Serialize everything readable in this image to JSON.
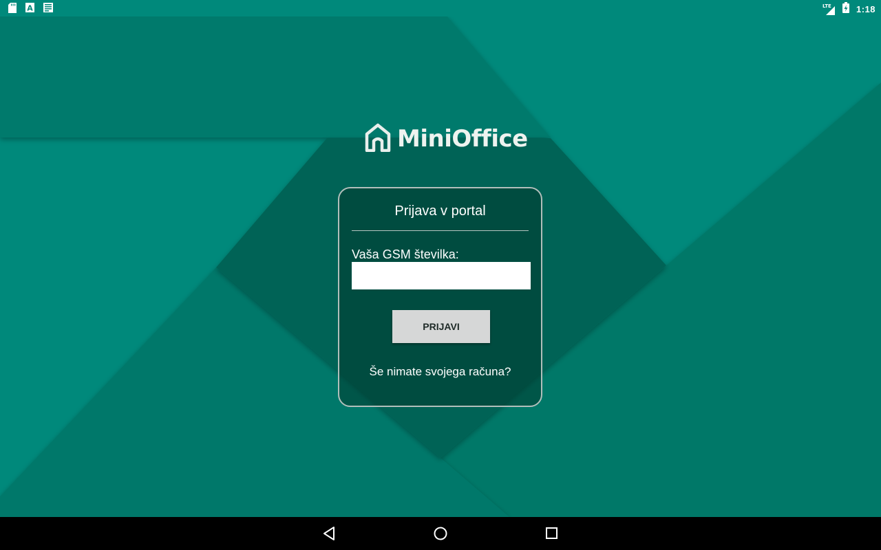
{
  "status_bar": {
    "left_icons": [
      "sd-card-icon",
      "keyboard-a-icon",
      "notes-icon"
    ],
    "network_label": "LTE",
    "right_icons": [
      "signal-icon",
      "battery-charging-icon"
    ],
    "time": "1:18"
  },
  "app": {
    "logo_icon": "house-icon",
    "logo_text": "MiniOffice"
  },
  "login": {
    "title": "Prijava v portal",
    "gsm_label": "Vaša GSM številka:",
    "gsm_value": "",
    "gsm_placeholder": "",
    "submit_label": "PRIJAVI",
    "register_link": "Še nimate svojega računa?"
  },
  "nav_bar": {
    "buttons": [
      "back-icon",
      "home-icon",
      "recents-icon"
    ]
  },
  "colors": {
    "background": "#00897b",
    "card": "#00473c",
    "button": "#d6d7d7",
    "nav_bar": "#000000"
  }
}
